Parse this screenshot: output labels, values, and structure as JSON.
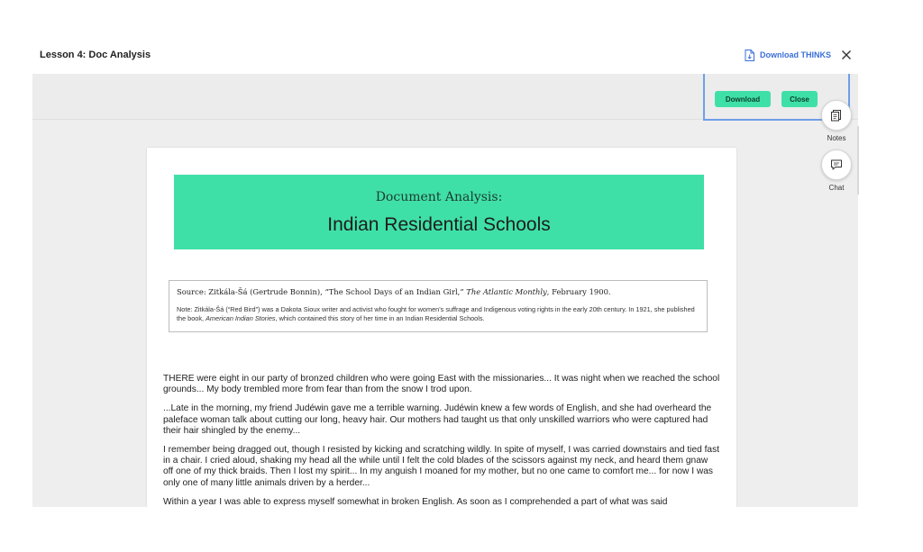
{
  "header": {
    "lesson_title": "Lesson 4: Doc Analysis",
    "download_link": "Download THINKS",
    "download_icon": "file-download-icon",
    "close_icon": "close-x-icon"
  },
  "toolbar": {
    "download_label": "Download",
    "close_label": "Close",
    "accent": "#3fe0a8",
    "highlight_border": "#6f9ee8"
  },
  "side_tools": [
    {
      "label": "Notes",
      "icon": "notes-icon"
    },
    {
      "label": "Chat",
      "icon": "chat-icon"
    }
  ],
  "document": {
    "banner_subtitle": "Document Analysis:",
    "banner_title": "Indian Residential Schools",
    "banner_color": "#3fe0a8",
    "source_prefix": "Source: Zitkála-Šá (Gertrude Bonnin), “The School Days of an Indian Girl,” ",
    "source_publication": "The Atlantic Monthly",
    "source_date": ", February 1900.",
    "note_prefix": "Note: Zitkála-Šá (“Red Bird”) was a Dakota Sioux writer and activist who fought for women’s suffrage and Indigenous voting rights in the early 20th century. In 1921, she published the book, ",
    "note_book": "American Indian Stories",
    "note_suffix": ", which contained this story of her time in an Indian Residential Schools.",
    "paragraphs": [
      "THERE were eight in our party of bronzed children who were going East with the missionaries... It was night when we reached the school grounds... My body trembled more from fear than from the snow I trod upon.",
      "...Late in the morning, my friend Judéwin gave me a terrible warning. Judéwin knew a few words of English, and she had overheard the paleface woman talk about cutting our long, heavy hair. Our mothers had taught us that only unskilled warriors who were captured had their hair shingled by the enemy...",
      "I remember being dragged out, though I resisted by kicking and scratching wildly. In spite of myself, I was carried downstairs and tied fast in a chair. I cried aloud, shaking my head all the while until I felt the cold blades of the scissors against my neck, and heard them gnaw off one of my thick braids. Then I lost my spirit... In my anguish I moaned for my mother, but no one came to comfort me... for now I was only one of many little animals driven by a herder...",
      "Within a year I was able to express myself somewhat in broken English. As soon as I comprehended a part of what was said"
    ]
  }
}
